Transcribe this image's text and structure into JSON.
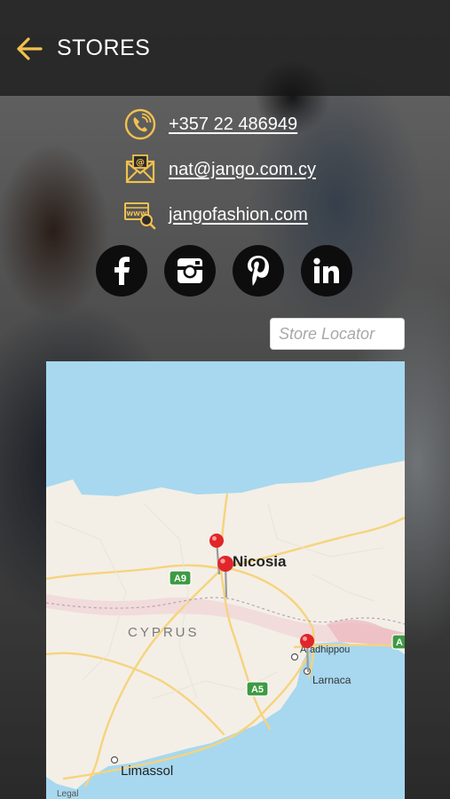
{
  "header": {
    "title": "STORES",
    "back_icon": "back-arrow-icon",
    "accent_color": "#F2C14E"
  },
  "contact": {
    "phone": "+357 22 486949",
    "email": "nat@jango.com.cy",
    "website": "jangofashion.com"
  },
  "socials": [
    {
      "name": "facebook",
      "icon": "facebook-icon"
    },
    {
      "name": "instagram",
      "icon": "instagram-icon"
    },
    {
      "name": "pinterest",
      "icon": "pinterest-icon"
    },
    {
      "name": "linkedin",
      "icon": "linkedin-icon"
    }
  ],
  "search": {
    "placeholder": "Store Locator",
    "value": ""
  },
  "map": {
    "country_label": "CYPRUS",
    "cities": {
      "nicosia": "Nicosia",
      "larnaca": "Larnaca",
      "aradhippou": "Aradhippou",
      "limassol": "Limassol"
    },
    "road_labels": {
      "a9": "A9",
      "a5": "A5",
      "a_east": "A"
    },
    "legal": "Legal",
    "pin_color": "#E0262A",
    "land_color": "#F3EFE6",
    "sea_color": "#A7D8EF"
  }
}
